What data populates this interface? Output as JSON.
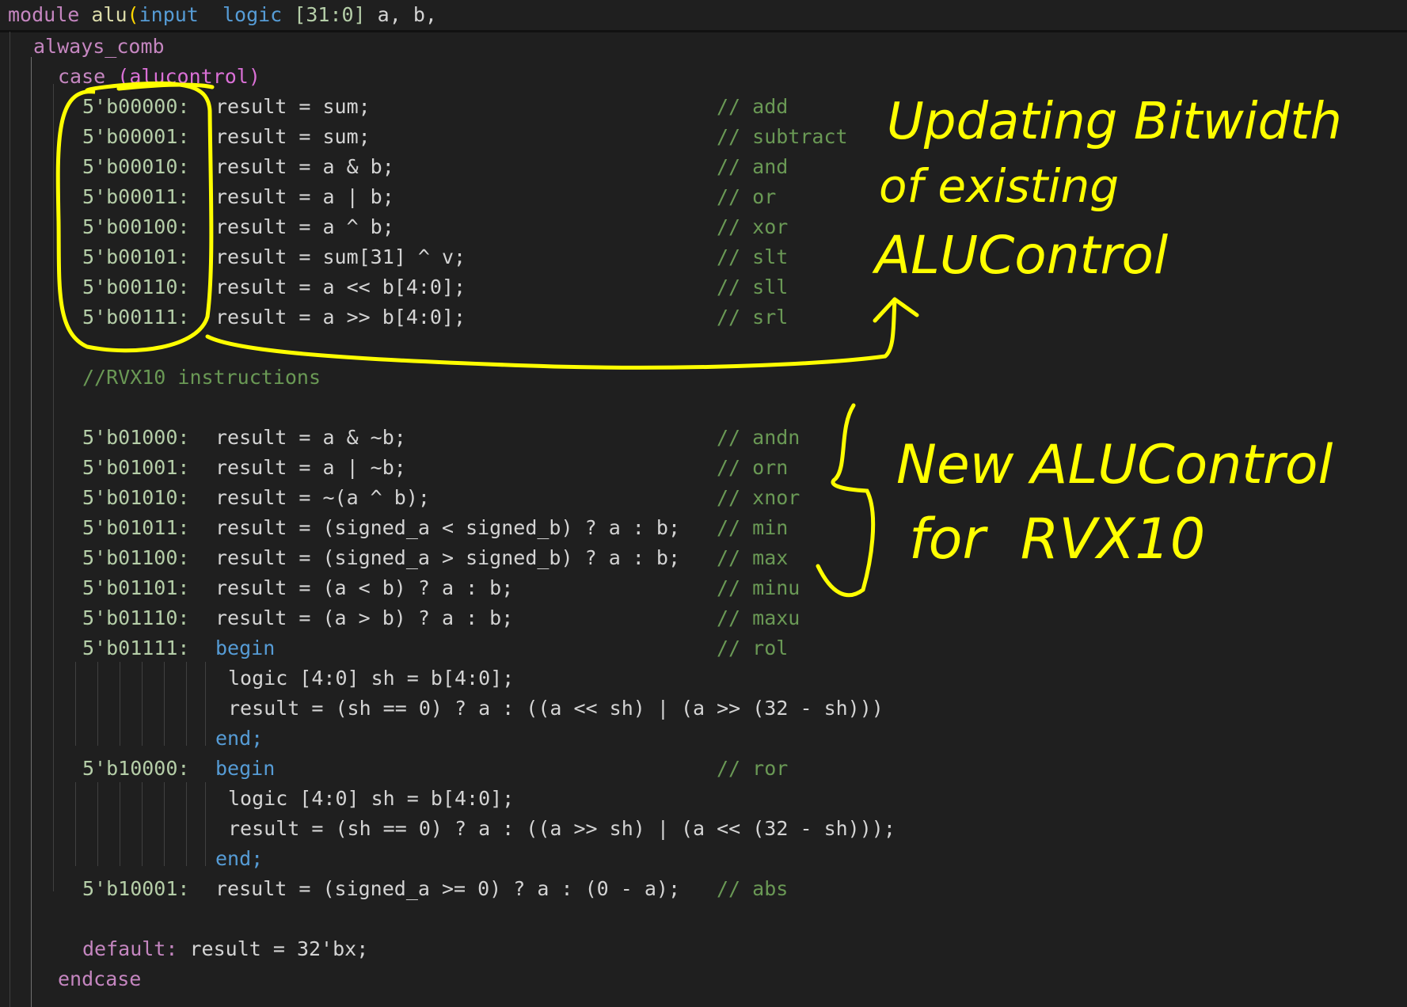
{
  "code": {
    "module_kw": "module",
    "module_name": "alu",
    "paren": "(",
    "input_kw": "input",
    "logic_kw": "logic",
    "range": "[31:0]",
    "ports": "a, b,",
    "always_comb": "always_comb",
    "case_kw": "case",
    "case_expr": "(alucontrol)",
    "rvx10_comment": "//RVX10 instructions",
    "rows": [
      {
        "code": "5'b00000:",
        "stmt": "result = sum;",
        "comment": "// add"
      },
      {
        "code": "5'b00001:",
        "stmt": "result = sum;",
        "comment": "// subtract"
      },
      {
        "code": "5'b00010:",
        "stmt": "result = a & b;",
        "comment": "// and"
      },
      {
        "code": "5'b00011:",
        "stmt": "result = a | b;",
        "comment": "// or"
      },
      {
        "code": "5'b00100:",
        "stmt": "result = a ^ b;",
        "comment": "// xor"
      },
      {
        "code": "5'b00101:",
        "stmt": "result = sum[31] ^ v;",
        "comment": "// slt"
      },
      {
        "code": "5'b00110:",
        "stmt": "result = a << b[4:0];",
        "comment": "// sll"
      },
      {
        "code": "5'b00111:",
        "stmt": "result = a >> b[4:0];",
        "comment": "// srl"
      },
      {
        "code": "5'b01000:",
        "stmt": "result = a & ~b;",
        "comment": "// andn"
      },
      {
        "code": "5'b01001:",
        "stmt": "result = a | ~b;",
        "comment": "// orn"
      },
      {
        "code": "5'b01010:",
        "stmt": "result = ~(a ^ b);",
        "comment": "// xnor"
      },
      {
        "code": "5'b01011:",
        "stmt": "result = (signed_a < signed_b) ? a : b;",
        "comment": "// min"
      },
      {
        "code": "5'b01100:",
        "stmt": "result = (signed_a > signed_b) ? a : b;",
        "comment": "// max"
      },
      {
        "code": "5'b01101:",
        "stmt": "result = (a < b) ? a : b;",
        "comment": "// minu"
      },
      {
        "code": "5'b01110:",
        "stmt": "result = (a > b) ? a : b;",
        "comment": "// maxu"
      },
      {
        "code": "5'b01111:",
        "stmt": "begin",
        "comment": "// rol"
      },
      {
        "code": "",
        "stmt": "logic [4:0] sh = b[4:0];",
        "comment": ""
      },
      {
        "code": "",
        "stmt": "result = (sh == 0) ? a : ((a << sh) | (a >> (32 - sh)))",
        "comment": ""
      },
      {
        "code": "",
        "stmt": "end;",
        "comment": ""
      },
      {
        "code": "5'b10000:",
        "stmt": "begin",
        "comment": "// ror"
      },
      {
        "code": "",
        "stmt": "logic [4:0] sh = b[4:0];",
        "comment": ""
      },
      {
        "code": "",
        "stmt": "result = (sh == 0) ? a : ((a >> sh) | (a << (32 - sh)));",
        "comment": ""
      },
      {
        "code": "",
        "stmt": "end;",
        "comment": ""
      },
      {
        "code": "5'b10001:",
        "stmt": "result = (signed_a >= 0) ? a : (0 - a);",
        "comment": "// abs"
      }
    ],
    "default_kw": "default:",
    "default_stmt": "result = 32'bx;",
    "endcase_kw": "endcase"
  },
  "annotations": {
    "note1_line1": "Updating Bitwidth",
    "note1_line2": "of existing",
    "note1_line3": "ALUControl",
    "note2_line1": "New ALUControl",
    "note2_line2": "for  RVX10",
    "ink_color": "#ffff00"
  },
  "theme": {
    "background": "#1f1f1f",
    "keyword": "#c586c0",
    "function": "#dcdcaa",
    "type": "#569cd6",
    "number": "#b5cea8",
    "comment": "#6a9955",
    "text": "#d4d4d4"
  }
}
